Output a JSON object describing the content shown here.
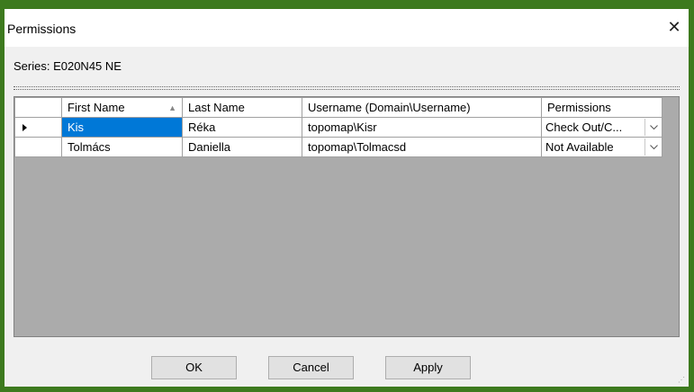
{
  "window": {
    "title": "Permissions",
    "close_glyph": "✕"
  },
  "series_label": "Series: E020N45 NE",
  "grid": {
    "columns": [
      "First Name",
      "Last Name",
      "Username (Domain\\Username)",
      "Permissions"
    ],
    "sort_column": "First Name",
    "sort_direction": "ascending",
    "rows": [
      {
        "first": "Kis",
        "last": "Réka",
        "username": "topomap\\Kisr",
        "permission": "Check Out/C...",
        "current": true
      },
      {
        "first": "Tolmács",
        "last": "Daniella",
        "username": "topomap\\Tolmacsd",
        "permission": "Not Available",
        "current": false
      }
    ]
  },
  "buttons": {
    "ok": "OK",
    "cancel": "Cancel",
    "apply": "Apply"
  },
  "colors": {
    "selection": "#0078d7",
    "grid_background": "#ababab",
    "window_border": "#3d7a1e"
  },
  "icons": {
    "sort": "triangle-up-icon",
    "row_pointer": "row-pointer-icon",
    "dropdown": "chevron-down-icon",
    "close": "close-icon"
  }
}
